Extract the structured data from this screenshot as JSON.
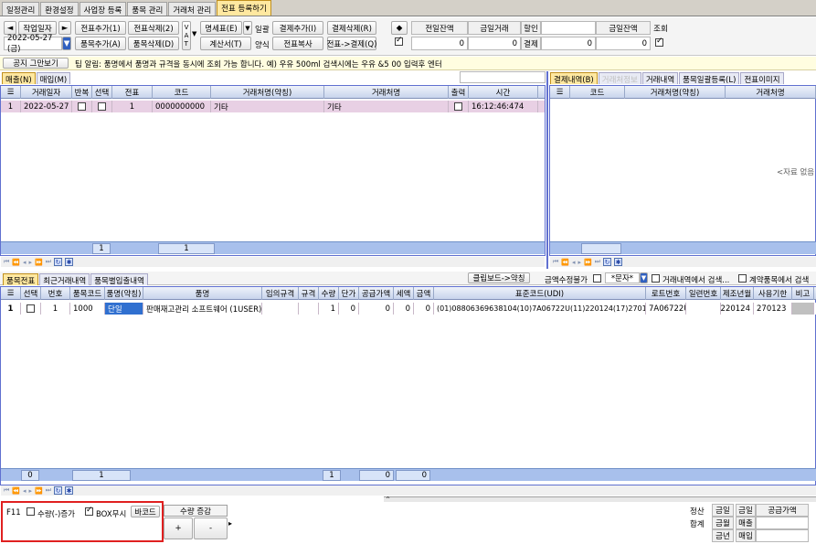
{
  "tabs": [
    "일정관리",
    "환경설정",
    "사업장 등록",
    "품목 관리",
    "거래처 관리",
    "전표 등록하기"
  ],
  "toolbar": {
    "prev_arrow": "◄",
    "next_arrow": "►",
    "work_date_btn": "작업일자",
    "date_value": "2022-05-27 (금)",
    "slip_add": "전표추가(1)",
    "slip_delete": "전표삭제(2)",
    "item_add": "품목추가(A)",
    "item_delete": "품목삭제(D)",
    "vat": "V\nA\nT",
    "statement": "명세표(E)",
    "batch": "일괄",
    "invoice": "계산서(T)",
    "form": "양식",
    "pay_add": "결제추가(I)",
    "pay_delete": "결제삭제(R)",
    "slip_copy": "전표복사",
    "slip_to_pay": "전표->결제(Q)",
    "diamond": "◆",
    "summary_headers": [
      "전일잔액",
      "금일거래",
      "할인",
      "금일잔액",
      "조회"
    ],
    "summary_values": [
      "0",
      "0",
      "결제",
      "0",
      "0"
    ]
  },
  "notice": {
    "stop_button": "공지 그만보기",
    "text": "팁 알림: 품명에서 품명과 규격을 동시에 조회 가능 합니다. 예) 우유 500ml 검색시에는 우유 &5 00 입력후 엔터"
  },
  "left_panel": {
    "tabs": [
      "매출(N)",
      "매입(M)"
    ],
    "columns": [
      "거래일자",
      "반복",
      "선택",
      "전표",
      "코드",
      "거래처명(약칭)",
      "거래처명",
      "출력",
      "시간"
    ],
    "rows": [
      {
        "no": "1",
        "date": "2022-05-27",
        "slip": "1",
        "code": "0000000000",
        "short_name": "기타",
        "name": "기타",
        "time": "16:12:46:474"
      }
    ],
    "footer": [
      "1",
      "1"
    ]
  },
  "right_panel": {
    "tabs": [
      "결제내역(B)",
      "거래처정보",
      "거래내역",
      "품목일괄등록(L)",
      "전표이미지"
    ],
    "columns": [
      "코드",
      "거래처명(약칭)",
      "거래처명"
    ],
    "empty_text": "<자료 없음"
  },
  "bottom_panel": {
    "tabs": [
      "품목전표",
      "최근거래내역",
      "품목별입출내역"
    ],
    "clipboard_btn": "클립보드->약칭",
    "amount_edit": "금액수정불가",
    "filter_value": "*문자*",
    "search_trade": "거래내역에서 검색...",
    "search_contract": "계약품목에서 검색",
    "columns": [
      "선택",
      "번호",
      "품목코드",
      "품명(약칭)",
      "품명",
      "임의규격",
      "규격",
      "수량",
      "단가",
      "공급가액",
      "세액",
      "금액",
      "표준코드(UDI)",
      "로트번호",
      "일련번호",
      "제조년월",
      "사용기한",
      "비고"
    ],
    "rows": [
      {
        "no": "1",
        "num": "1",
        "code": "1000",
        "short_name": "단일",
        "name": "판매재고관리 소프트웨어 (1USER)",
        "qty": "1",
        "price": "0",
        "supply": "0",
        "tax": "0",
        "amount": "0",
        "udi": "(01)08806369638104(10)7A06722U(11)220124(17)270123",
        "lot": "7A06722U",
        "mfg": "220124",
        "exp": "270123"
      }
    ],
    "footer": [
      "0",
      "1",
      "1",
      "0",
      "0"
    ]
  },
  "bottom_controls": {
    "f11": "F11",
    "qty_minus_increase": "수량(-)증가",
    "box_show": "BOX무시",
    "barcode": "바코드",
    "qty_adjust": "수량 증감",
    "plus": "+",
    "minus": "-",
    "settle": "정산",
    "total": "합계",
    "day": "금일",
    "month": "금월",
    "year": "금년",
    "kind_day": "금일",
    "sales": "매출",
    "purchase": "매입",
    "supply_amount": "공급가액"
  },
  "colors": {
    "grid_header": "#c8d4ec",
    "selected_row": "#e8d0e4",
    "footer_bar": "#a8c0ec",
    "active_tab": "#ffe8a0",
    "highlight_border": "#e02020"
  }
}
